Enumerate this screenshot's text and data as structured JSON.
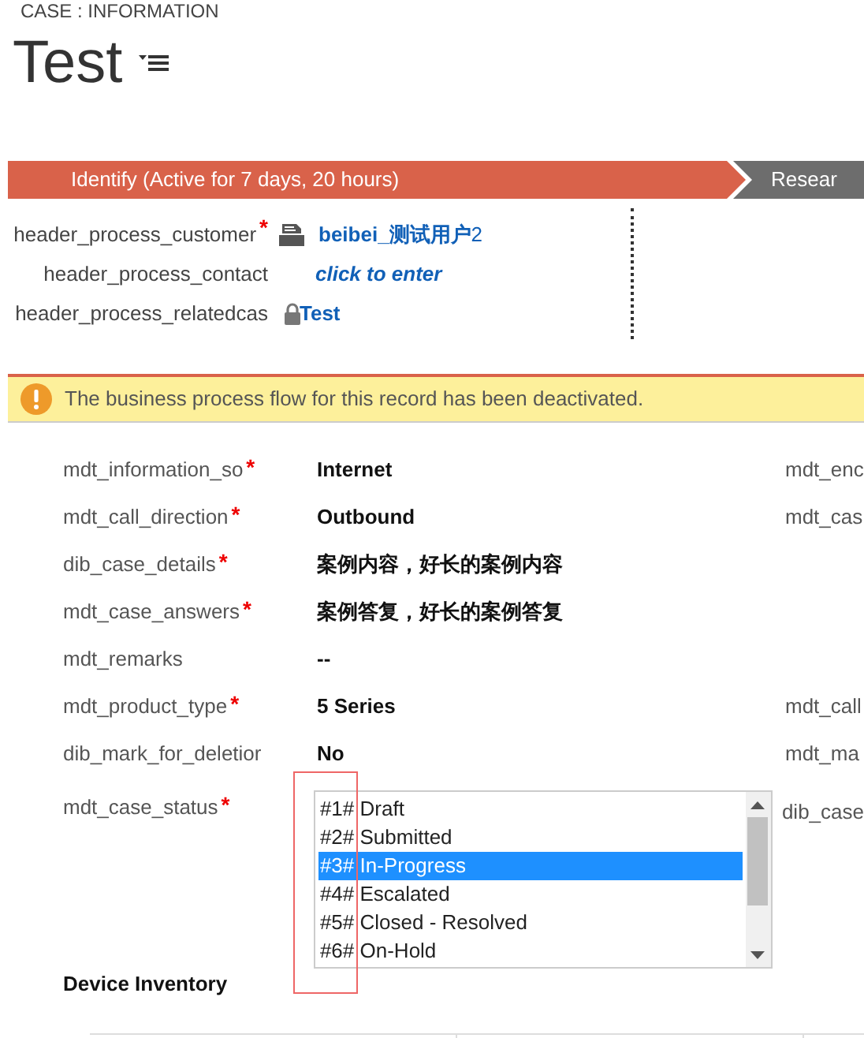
{
  "header": {
    "entity": "CASE : INFORMATION",
    "title": "Test"
  },
  "process_stages": [
    {
      "label": "Identify (Active for 7 days, 20 hours)",
      "selected": true
    },
    {
      "label": "Resear",
      "selected": false
    }
  ],
  "header_fields": [
    {
      "label": "header_process_customer",
      "required_mark": "*",
      "kind": "lookup",
      "value": "**beibei_测试用户**2"
    },
    {
      "label": "header_process_contact",
      "kind": "empty",
      "value": "click to enter"
    },
    {
      "label": "header_process_relatedcas",
      "kind": "locked",
      "value": "Test"
    }
  ],
  "notification": {
    "text": "The business process flow for this record has been deactivated."
  },
  "form_fields": [
    {
      "label": "mdt_information_so",
      "required_mark": "*",
      "kind": "text",
      "value": "Internet",
      "side_label": "mdt_enc"
    },
    {
      "label": "mdt_call_direction",
      "required_mark": "*",
      "kind": "text",
      "value": "Outbound",
      "side_label": "mdt_cas"
    },
    {
      "label": "dib_case_details",
      "required_mark": "*",
      "kind": "text",
      "value": "案例内容，好长的案例内容"
    },
    {
      "label": "mdt_case_answers",
      "required_mark": "*",
      "kind": "text",
      "value": "案例答复，好长的案例答复"
    },
    {
      "label": "mdt_remarks",
      "kind": "text",
      "value": "--"
    },
    {
      "label": "mdt_product_type",
      "required_mark": "*",
      "kind": "text",
      "value": "5 Series",
      "side_label": "mdt_call"
    },
    {
      "label": "dib_mark_for_deletior",
      "kind": "text",
      "value": "No",
      "side_label": "mdt_ma"
    },
    {
      "label": "mdt_case_status",
      "required_mark": "*",
      "kind": "listbox",
      "side_label": "dib_case",
      "options": [
        {
          "label": "#1# Draft",
          "selected": false
        },
        {
          "label": "#2# Submitted",
          "selected": false
        },
        {
          "label": "#3# In-Progress",
          "selected": true
        },
        {
          "label": "#4# Escalated",
          "selected": false
        },
        {
          "label": "#5# Closed - Resolved",
          "selected": false
        },
        {
          "label": "#6# On-Hold",
          "selected": false
        }
      ]
    }
  ],
  "section": {
    "title": "Device Inventory"
  }
}
